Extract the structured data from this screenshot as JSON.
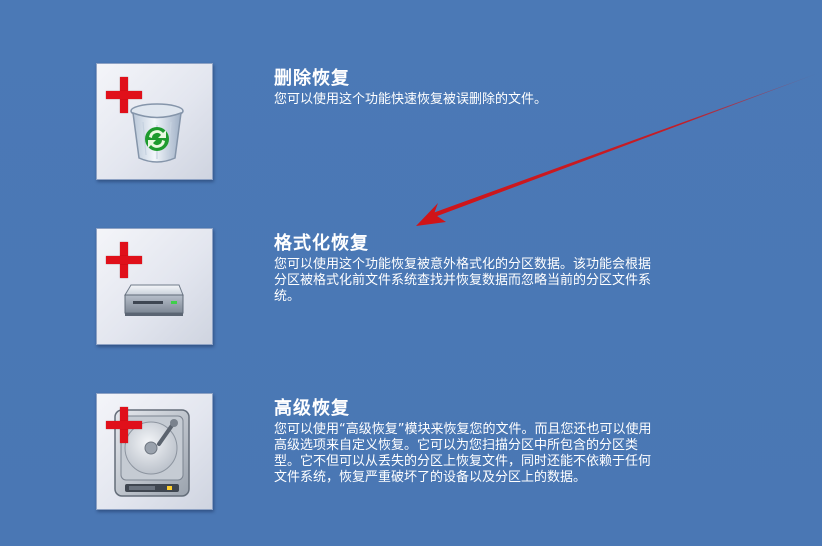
{
  "options": [
    {
      "title": "删除恢复",
      "description": "您可以使用这个功能快速恢复被误删除的文件。",
      "icon": "recycle-bin-icon"
    },
    {
      "title": "格式化恢复",
      "description": "您可以使用这个功能恢复被意外格式化的分区数据。该功能会根据分区被格式化前文件系统查找并恢复数据而忽略当前的分区文件系统。",
      "icon": "drive-icon"
    },
    {
      "title": "高级恢复",
      "description": "您可以使用“高级恢复”模块来恢复您的文件。而且您还也可以使用高级选项来自定义恢复。它可以为您扫描分区中所包含的分区类型。它不但可以从丢失的分区上恢复文件，同时还能不依赖于任何文件系统，恢复严重破坏了的设备以及分区上的数据。",
      "icon": "hard-disk-icon"
    }
  ],
  "colors": {
    "background": "#4a78b5",
    "plus": "#e0101a",
    "arrow": "#d01418",
    "text": "#ffffff"
  }
}
